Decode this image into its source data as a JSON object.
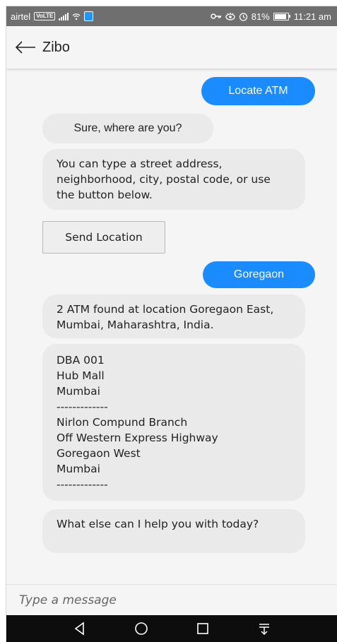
{
  "status_bar": {
    "carrier": "airtel",
    "volte": "VoLTE",
    "battery": "81%",
    "battery_level": 0.81,
    "time": "11:21 am"
  },
  "header": {
    "title": "Zibo",
    "back_icon": "arrow-left-icon"
  },
  "messages": [
    {
      "from": "user",
      "text": "Locate ATM"
    },
    {
      "from": "bot",
      "text": "Sure, where are you?"
    },
    {
      "from": "bot",
      "text": "You can type a street address, neighborhood, city, postal code, or use the button below."
    },
    {
      "from": "user",
      "text": "Goregaon"
    },
    {
      "from": "bot",
      "text": "2 ATM found at location Goregaon East, Mumbai, Maharashtra, India."
    },
    {
      "from": "bot",
      "lines": [
        "DBA 001",
        "Hub Mall",
        "Mumbai",
        "-------------",
        "Nirlon Compund Branch",
        "Off Western Express Highway",
        "Goregaon West",
        "Mumbai",
        "-------------"
      ]
    },
    {
      "from": "bot",
      "text": "What else can I help you with today?"
    }
  ],
  "quick_reply": {
    "label": "Send Location"
  },
  "composer": {
    "placeholder": "Type a message"
  },
  "colors": {
    "user_bubble": "#1a8cff",
    "bot_bubble": "#eaeaea",
    "nav_bar": "#0d0d0d"
  }
}
